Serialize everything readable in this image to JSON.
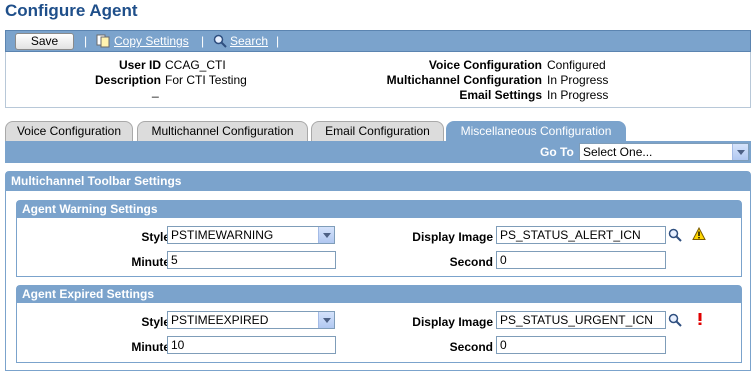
{
  "page": {
    "title": "Configure Agent"
  },
  "toolbar": {
    "save_label": "Save",
    "copy_settings_label": "Copy Settings",
    "search_label": "Search",
    "separator": "|"
  },
  "info": {
    "user_id_label": "User ID",
    "user_id_value": "CCAG_CTI",
    "description_label": "Description",
    "description_value": "For CTI Testing",
    "dash": "_",
    "voice_config_label": "Voice Configuration",
    "voice_config_value": "Configured",
    "multichannel_config_label": "Multichannel Configuration",
    "multichannel_config_value": "In Progress",
    "email_settings_label": "Email Settings",
    "email_settings_value": "In Progress"
  },
  "tabs": [
    {
      "label": "Voice Configuration",
      "active": false
    },
    {
      "label": "Multichannel Configuration",
      "active": false
    },
    {
      "label": "Email Configuration",
      "active": false
    },
    {
      "label": "Miscellaneous Configuration",
      "active": true
    }
  ],
  "goto": {
    "label": "Go To",
    "value": "Select One..."
  },
  "toolbar_settings": {
    "title": "Multichannel Toolbar Settings",
    "warning": {
      "title": "Agent Warning Settings",
      "style_label": "Style",
      "style_value": "PSTIMEWARNING",
      "minute_label": "Minute",
      "minute_value": "5",
      "image_label": "Display Image",
      "image_value": "PS_STATUS_ALERT_ICN",
      "second_label": "Second",
      "second_value": "0"
    },
    "expired": {
      "title": "Agent Expired Settings",
      "style_label": "Style",
      "style_value": "PSTIMEEXPIRED",
      "minute_label": "Minute",
      "minute_value": "10",
      "image_label": "Display Image",
      "image_value": "PS_STATUS_URGENT_ICN",
      "second_label": "Second",
      "second_value": "0"
    }
  },
  "colors": {
    "header_blue": "#7ba3cc",
    "title_blue": "#1f4f8a"
  },
  "icons": [
    "copy-settings-icon",
    "search-icon",
    "lookup-icon",
    "warning-icon",
    "urgent-icon",
    "dropdown-arrow-icon"
  ]
}
